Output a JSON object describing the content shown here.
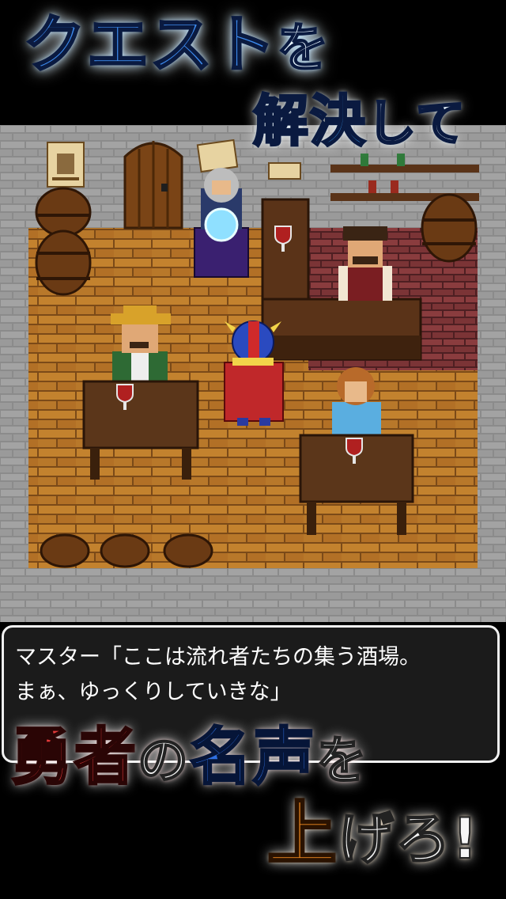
{
  "promo": {
    "line1_main": "クエスト",
    "line1_particle": "を",
    "line2_main": "解決",
    "line2_tail": "して",
    "line3_part1": "勇者",
    "line3_particle1": "の",
    "line3_part2": "名声",
    "line3_particle2": "を",
    "line4_main": "上",
    "line4_tail": "げろ!"
  },
  "dialog": {
    "line1": "マスター「ここは流れ者たちの集う酒場。",
    "line2": "まぁ、ゆっくりしていきな」"
  },
  "scene": {
    "props": [
      "wanted-poster",
      "wooden-door",
      "notice-paper",
      "barrels",
      "wine-shelf",
      "crystal-ball",
      "bar-counter",
      "tables",
      "wine-glasses",
      "stools"
    ],
    "characters": [
      "fortune-teller",
      "bartender-master",
      "farmer-villager",
      "hero-player",
      "girl-villager"
    ],
    "colors": {
      "floor": "#b7752a",
      "wall_stone": "#8a8a8a",
      "brick_back": "#7a3436",
      "counter": "#5a3318",
      "table": "#5b361a"
    }
  }
}
